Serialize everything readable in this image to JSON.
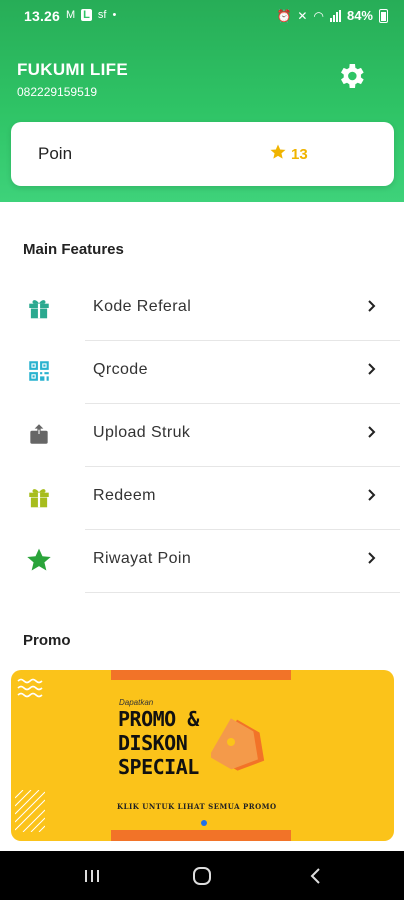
{
  "status_bar": {
    "time": "13.26",
    "notifications": [
      "M",
      "L",
      "sf",
      "•"
    ],
    "battery": "84%"
  },
  "user": {
    "name": "FUKUMI LIFE",
    "phone": "082229159519"
  },
  "points": {
    "label": "Poin",
    "value": "13"
  },
  "main_features": {
    "title": "Main Features",
    "items": [
      {
        "label": "Kode Referal",
        "icon": "gift-icon",
        "color": "#2aa98f"
      },
      {
        "label": "Qrcode",
        "icon": "qr-code-icon",
        "color": "#29b2cf"
      },
      {
        "label": "Upload Struk",
        "icon": "upload-box-icon",
        "color": "#666666"
      },
      {
        "label": "Redeem",
        "icon": "gift-icon",
        "color": "#a7bd1d"
      },
      {
        "label": "Riwayat Poin",
        "icon": "star-icon",
        "color": "#2aa43a"
      }
    ]
  },
  "promo": {
    "title": "Promo",
    "banner": {
      "small_text": "Dapatkan",
      "headline": "PROMO & DISKON SPECIAL",
      "cta": "KLIK UNTUK LIHAT SEMUA PROMO"
    }
  },
  "colors": {
    "header_green": "#2fc466",
    "accent_gold": "#f0b400",
    "promo_yellow": "#fbc31a",
    "promo_orange": "#f27328"
  }
}
